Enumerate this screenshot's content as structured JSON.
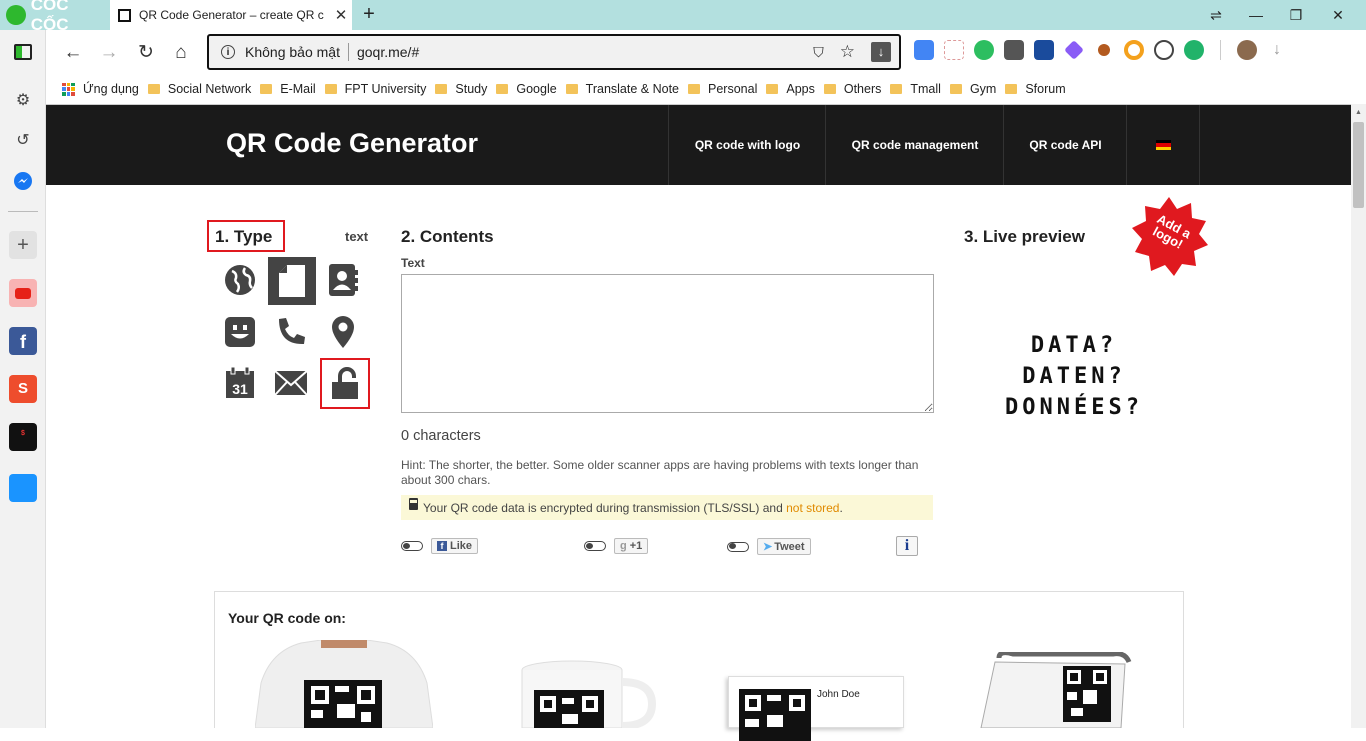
{
  "browser": {
    "brand": "CỐC CỐC",
    "tab_title": "QR Code Generator – create QR c",
    "tab_close": "✕",
    "new_tab": "+",
    "window_controls": [
      "⇌",
      "—",
      "❐",
      "✕"
    ],
    "omnibox": {
      "security": "Không bảo mật",
      "url": "goqr.me/#"
    }
  },
  "bookmarks": [
    "Ứng dụng",
    "Social Network",
    "E-Mail",
    "FPT University",
    "Study",
    "Google",
    "Translate & Note",
    "Personal",
    "Apps",
    "Others",
    "Tmall",
    "Gym",
    "Sforum"
  ],
  "sidebar": {
    "items": [
      "settings",
      "history",
      "messenger",
      "add",
      "youtube",
      "facebook",
      "shopee",
      "black-friday",
      "tiki"
    ]
  },
  "site": {
    "title": "QR Code Generator",
    "nav": [
      "QR code with logo",
      "QR code management",
      "QR code API"
    ]
  },
  "type_panel": {
    "heading": "1. Type",
    "current": "text",
    "calendar_day": "31"
  },
  "contents_panel": {
    "heading": "2. Contents",
    "field_label": "Text",
    "value": "",
    "char_count": "0 characters",
    "hint": "Hint: The shorter, the better. Some older scanner apps are having problems with texts longer than about 300 chars.",
    "encrypted_note": "Your QR code data is encrypted during transmission (TLS/SSL) and",
    "not_stored": "not stored",
    "period": ".",
    "like": "Like",
    "plus_one": "+1",
    "tweet": "Tweet",
    "info": "i"
  },
  "preview_panel": {
    "heading": "3. Live preview",
    "badge": "Add a logo!",
    "placeholder_lines": [
      "DATA?",
      "DATEN?",
      "DONNÉES?"
    ]
  },
  "products": {
    "heading": "Your QR code on:",
    "business_card_name": "John Doe"
  }
}
